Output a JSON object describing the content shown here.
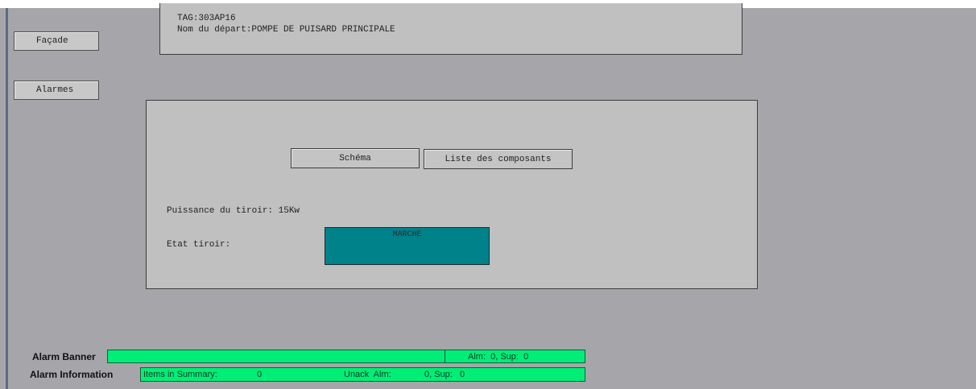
{
  "colors": {
    "background": "#a6a6aa",
    "panel": "#c0c0c0",
    "state_running": "#00828a",
    "alarm_green": "#00ee77"
  },
  "nav": {
    "facade": "Façade",
    "alarmes": "Alarmes"
  },
  "info": {
    "tag": "TAG:303AP16",
    "departure": "Nom du départ:POMPE DE PUISARD PRINCIPALE"
  },
  "main": {
    "schema_button": "Schéma",
    "components_button": "Liste des composants",
    "power_label": "Puissance du tiroir: 15Kw",
    "state_label": "Etat tiroir:",
    "state_value": "MARCHE"
  },
  "alarm_banner": {
    "label": "Alarm Banner",
    "counts": "Alm:  0, Sup:  0"
  },
  "alarm_information": {
    "label": "Alarm Information",
    "items_label": "Items in Summary:",
    "items_value": "0",
    "unack_label": "Unack  Alm:",
    "unack_counts": "0, Sup:   0"
  }
}
